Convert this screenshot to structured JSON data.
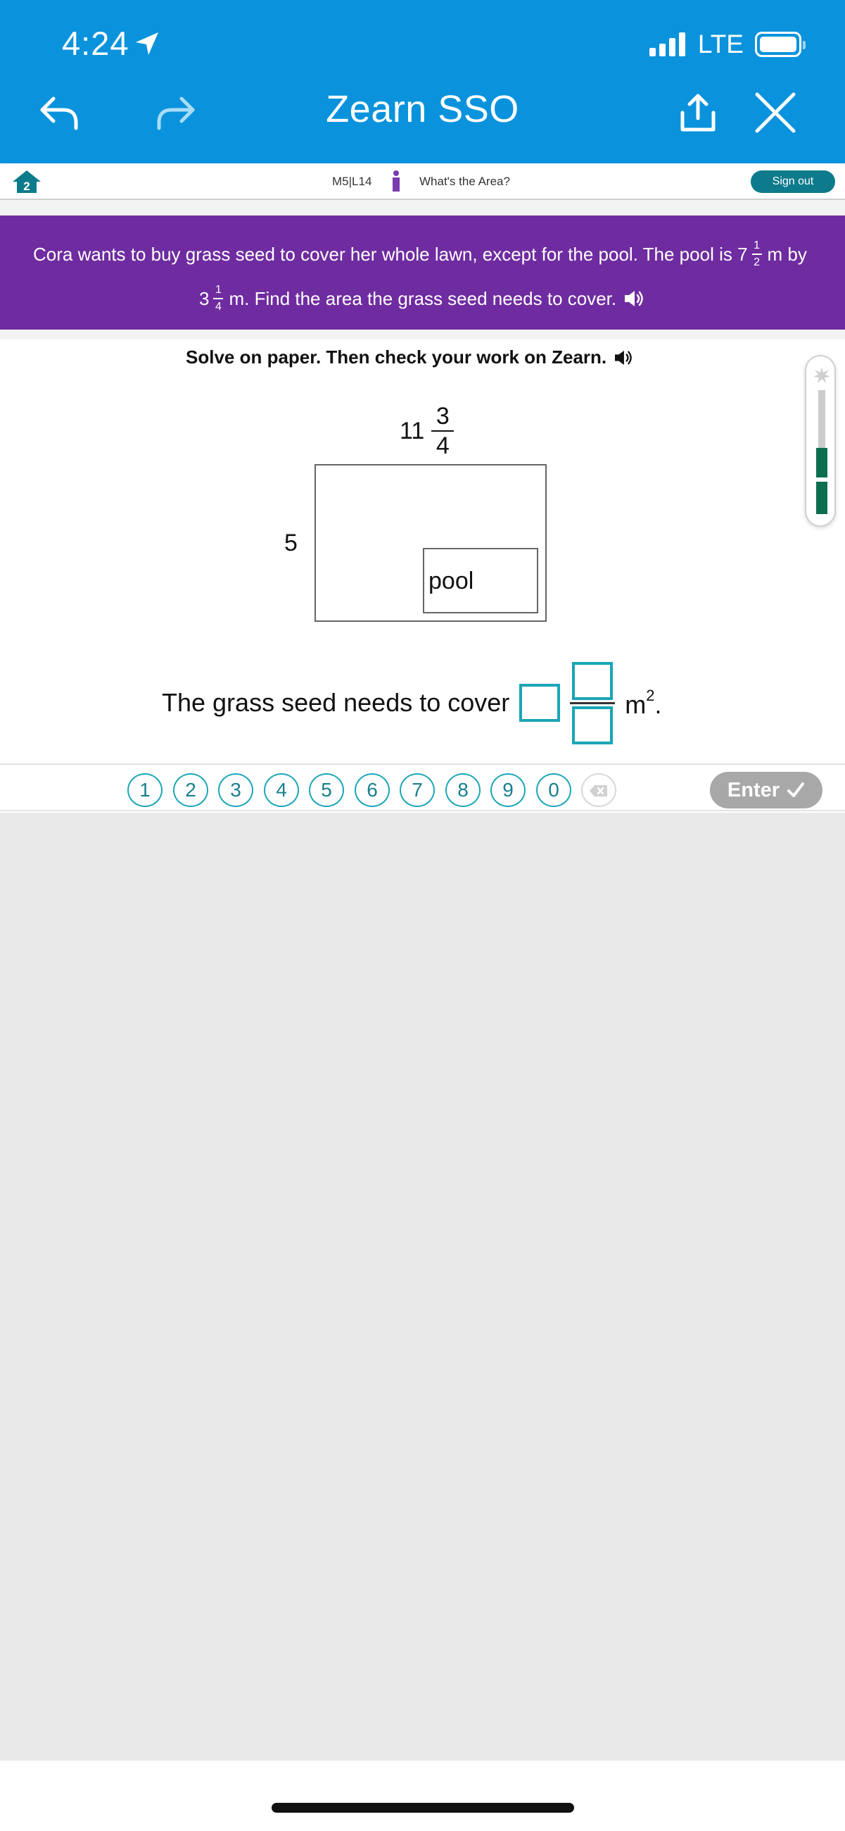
{
  "status_bar": {
    "time": "4:24",
    "network": "LTE",
    "icons": [
      "location-arrow-icon",
      "signal-icon",
      "battery-icon"
    ]
  },
  "browser_bar": {
    "title": "Zearn SSO",
    "icons": [
      "back-arrow-icon",
      "forward-arrow-icon",
      "share-icon",
      "close-icon"
    ]
  },
  "lesson_header": {
    "lesson_code": "M5|L14",
    "lesson_title": "What's the Area?",
    "sign_out_label": "Sign out"
  },
  "prompt": {
    "line1_text": "Cora wants to buy grass seed to cover her whole lawn, except for the pool. The pool is 7",
    "pool_length_num": "1",
    "pool_length_den": "2",
    "line1_end": "m by",
    "pool_width_whole": "3",
    "pool_width_num": "1",
    "pool_width_den": "4",
    "line2_text": "m. Find the area the grass seed needs to cover."
  },
  "instructions": "Solve on paper. Then check your work on Zearn.",
  "diagram": {
    "length_whole": "11",
    "length_num": "3",
    "length_den": "4",
    "width": "5",
    "pool_label": "pool"
  },
  "answer": {
    "text": "The grass seed needs to cover",
    "unit": "m",
    "unit_exp": "2",
    "period": "."
  },
  "keypad": {
    "keys": [
      "1",
      "2",
      "3",
      "4",
      "5",
      "6",
      "7",
      "8",
      "9",
      "0"
    ],
    "enter_label": "Enter"
  },
  "colors": {
    "app_bar": "#0a93dc",
    "prompt_bg": "#6f2ca0",
    "accent_teal": "#1aa6b7",
    "sign_out_bg": "#0d7b8c",
    "progress_green": "#0d6e4f"
  }
}
